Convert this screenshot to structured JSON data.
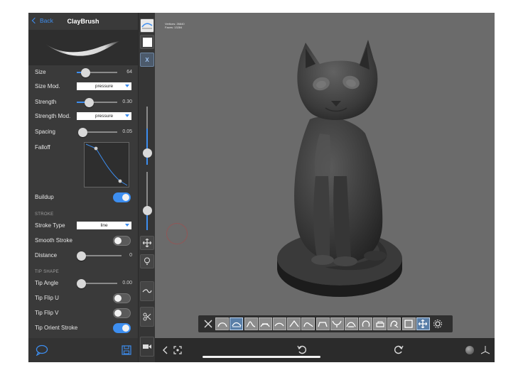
{
  "header": {
    "back_label": "Back",
    "title": "ClayBrush"
  },
  "brush": {
    "size": {
      "label": "Size",
      "value": "64",
      "fraction": 0.22
    },
    "size_mod": {
      "label": "Size Mod.",
      "selected": "pressure"
    },
    "strength": {
      "label": "Strength",
      "value": "0.30",
      "fraction": 0.3
    },
    "strength_mod": {
      "label": "Strength Mod.",
      "selected": "pressure"
    },
    "spacing": {
      "label": "Spacing",
      "value": "0.05",
      "fraction": 0.05
    },
    "falloff": {
      "label": "Falloff"
    },
    "buildup": {
      "label": "Buildup",
      "on": true
    }
  },
  "stroke_section": {
    "title": "STROKE",
    "stroke_type": {
      "label": "Stroke Type",
      "selected": "line"
    },
    "smooth_stroke": {
      "label": "Smooth Stroke",
      "on": false
    },
    "distance": {
      "label": "Distance",
      "value": "0",
      "fraction": 0.0
    }
  },
  "tip_section": {
    "title": "TIP SHAPE",
    "tip_angle": {
      "label": "Tip Angle",
      "value": "0.00",
      "fraction": 0.0
    },
    "tip_flip_u": {
      "label": "Tip Flip U",
      "on": false
    },
    "tip_flip_v": {
      "label": "Tip Flip V",
      "on": false
    },
    "tip_orient_stroke": {
      "label": "Tip Orient Stroke",
      "on": true
    }
  },
  "toolstrip": {
    "symmetry_label": "X",
    "radius_fraction": 0.62,
    "strength_fraction": 0.35
  },
  "viewport": {
    "stats_line1": "Vertices: 26640",
    "stats_line2": "Faces:    13284"
  },
  "colors": {
    "accent": "#3d8ef0",
    "panel": "#3a3a3a",
    "viewport": "#6b6b6b"
  }
}
